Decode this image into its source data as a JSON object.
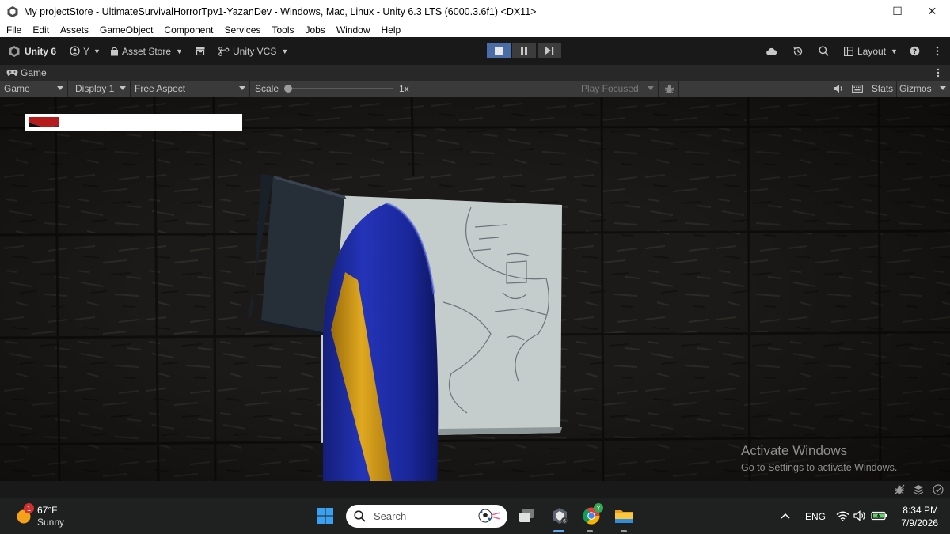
{
  "window": {
    "title": "My projectStore - UltimateSurvivalHorrorTpv1-YazanDev - Windows, Mac, Linux - Unity 6.3 LTS (6000.3.6f1) <DX11>",
    "minimize": "—",
    "maximize": "☐",
    "close": "✕"
  },
  "menu": [
    "File",
    "Edit",
    "Assets",
    "GameObject",
    "Component",
    "Services",
    "Tools",
    "Jobs",
    "Window",
    "Help"
  ],
  "toolbar": {
    "unity_label": "Unity 6",
    "account_label": "Y",
    "asset_store_label": "Asset Store",
    "vcs_label": "Unity VCS",
    "layout_label": "Layout"
  },
  "tab": {
    "label": "Game"
  },
  "gamebar": {
    "view_select": "Game",
    "display_select": "Display 1",
    "aspect_select": "Free Aspect",
    "scale_label": "Scale",
    "scale_value": "1x",
    "play_mode_select": "Play Focused",
    "stats_label": "Stats",
    "gizmos_label": "Gizmos"
  },
  "overlay": {
    "activate_title": "Activate Windows",
    "activate_subtitle": "Go to Settings to activate Windows."
  },
  "taskbar": {
    "weather_temp": "67°F",
    "weather_desc": "Sunny",
    "weather_badge": "1",
    "search_placeholder": "Search",
    "chrome_badge": "Y",
    "language": "ENG",
    "time": "8:34 PM",
    "date": "7/9/2026"
  },
  "colors": {
    "accent": "#4a6da7",
    "editor_bg": "#191919",
    "health_bar_fill": "#b71c1c",
    "sword_blade": "#1f2fa8",
    "sword_stripe": "#d9a21b"
  }
}
